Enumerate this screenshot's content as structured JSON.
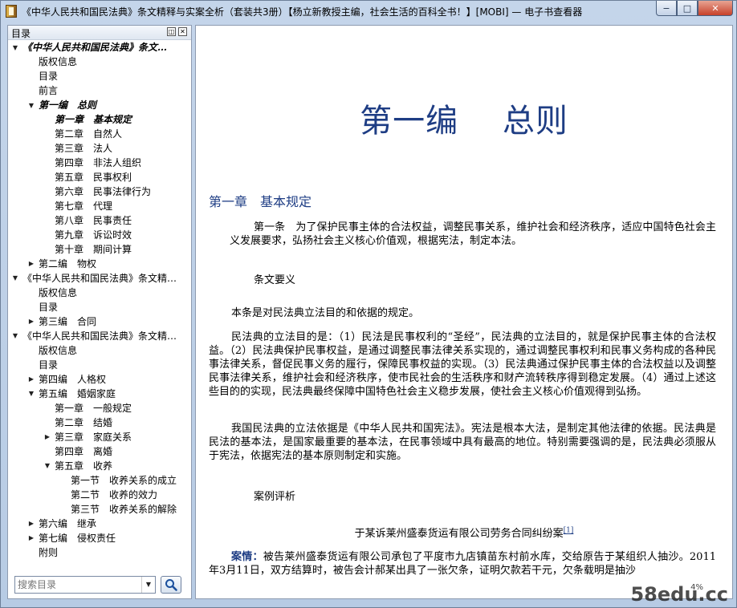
{
  "window": {
    "title": "《中华人民共和国民法典》条文精释与实案全析（套装共3册）【杨立新教授主编，社会生活的百科全书！】[MOBI] — 电子书查看器",
    "min_label": "−",
    "max_label": "□",
    "close_label": "✕"
  },
  "sidebar": {
    "title": "目录",
    "restore_btn": "◫",
    "close_btn": "✕",
    "search_placeholder": "搜索目录",
    "tree": [
      {
        "label": "《中华人民共和国民法典》条文…",
        "level": 0,
        "toggle": "▼",
        "style": "bold"
      },
      {
        "label": "版权信息",
        "level": 1,
        "toggle": ""
      },
      {
        "label": "目录",
        "level": 1,
        "toggle": ""
      },
      {
        "label": "前言",
        "level": 1,
        "toggle": ""
      },
      {
        "label": "第一编　总则",
        "level": 1,
        "toggle": "▼",
        "style": "bold"
      },
      {
        "label": "第一章　基本规定",
        "level": 2,
        "toggle": "",
        "style": "bold"
      },
      {
        "label": "第二章　自然人",
        "level": 2,
        "toggle": ""
      },
      {
        "label": "第三章　法人",
        "level": 2,
        "toggle": ""
      },
      {
        "label": "第四章　非法人组织",
        "level": 2,
        "toggle": ""
      },
      {
        "label": "第五章　民事权利",
        "level": 2,
        "toggle": ""
      },
      {
        "label": "第六章　民事法律行为",
        "level": 2,
        "toggle": ""
      },
      {
        "label": "第七章　代理",
        "level": 2,
        "toggle": ""
      },
      {
        "label": "第八章　民事责任",
        "level": 2,
        "toggle": ""
      },
      {
        "label": "第九章　诉讼时效",
        "level": 2,
        "toggle": ""
      },
      {
        "label": "第十章　期间计算",
        "level": 2,
        "toggle": ""
      },
      {
        "label": "第二编　物权",
        "level": 1,
        "toggle": "▶"
      },
      {
        "label": "《中华人民共和国民法典》条文精…",
        "level": 0,
        "toggle": "▼"
      },
      {
        "label": "版权信息",
        "level": 1,
        "toggle": ""
      },
      {
        "label": "目录",
        "level": 1,
        "toggle": ""
      },
      {
        "label": "第三编　合同",
        "level": 1,
        "toggle": "▶"
      },
      {
        "label": "《中华人民共和国民法典》条文精…",
        "level": 0,
        "toggle": "▼"
      },
      {
        "label": "版权信息",
        "level": 1,
        "toggle": ""
      },
      {
        "label": "目录",
        "level": 1,
        "toggle": ""
      },
      {
        "label": "第四编　人格权",
        "level": 1,
        "toggle": "▶"
      },
      {
        "label": "第五编　婚姻家庭",
        "level": 1,
        "toggle": "▼"
      },
      {
        "label": "第一章　一般规定",
        "level": 2,
        "toggle": ""
      },
      {
        "label": "第二章　结婚",
        "level": 2,
        "toggle": ""
      },
      {
        "label": "第三章　家庭关系",
        "level": 2,
        "toggle": "▶"
      },
      {
        "label": "第四章　离婚",
        "level": 2,
        "toggle": ""
      },
      {
        "label": "第五章　收养",
        "level": 2,
        "toggle": "▼"
      },
      {
        "label": "第一节　收养关系的成立",
        "level": 3,
        "toggle": ""
      },
      {
        "label": "第二节　收养的效力",
        "level": 3,
        "toggle": ""
      },
      {
        "label": "第三节　收养关系的解除",
        "level": 3,
        "toggle": ""
      },
      {
        "label": "第六编　继承",
        "level": 1,
        "toggle": "▶"
      },
      {
        "label": "第七编　侵权责任",
        "level": 1,
        "toggle": "▶"
      },
      {
        "label": "附则",
        "level": 1,
        "toggle": ""
      }
    ]
  },
  "content": {
    "part_title": "第一编　 总则",
    "chapter_title": "第一章　基本规定",
    "article1": "第一条　为了保护民事主体的合法权益，调整民事关系，维护社会和经济秩序，适应中国特色社会主义发展要求，弘扬社会主义核心价值观，根据宪法，制定本法。",
    "heading_gist": "条文要义",
    "para1": "本条是对民法典立法目的和依据的规定。",
    "para2": "民法典的立法目的是：（1）民法是民事权利的“圣经”，民法典的立法目的，就是保护民事主体的合法权益。（2）民法典保护民事权益，是通过调整民事法律关系实现的，通过调整民事权利和民事义务构成的各种民事法律关系，督促民事义务的履行，保障民事权益的实现。（3）民法典通过保护民事主体的合法权益以及调整民事法律关系，维护社会和经济秩序，使市民社会的生活秩序和财产流转秩序得到稳定发展。（4）通过上述这些目的的实现，民法典最终保障中国特色社会主义稳步发展，使社会主义核心价值观得到弘扬。",
    "para3": "我国民法典的立法依据是《中华人民共和国宪法》。宪法是根本大法，是制定其他法律的依据。民法典是民法的基本法，是国家最重要的基本法，在民事领域中具有最高的地位。特别需要强调的是，民法典必须服从于宪法，依据宪法的基本原则制定和实施。",
    "heading_case": "案例评析",
    "case_title": "于某诉莱州盛泰货运有限公司劳务合同纠纷案",
    "case_ref": "[1]",
    "case_label": "案情：",
    "case_text": "被告莱州盛泰货运有限公司承包了平度市九店镇苗东村前水库，交给原告于某组织人抽沙。2011年3月11日，双方结算时，被告会计郝某出具了一张欠条，证明欠款若干元，欠条载明是抽沙",
    "page_indicator": "4%",
    "watermark": "58edu.cc"
  }
}
